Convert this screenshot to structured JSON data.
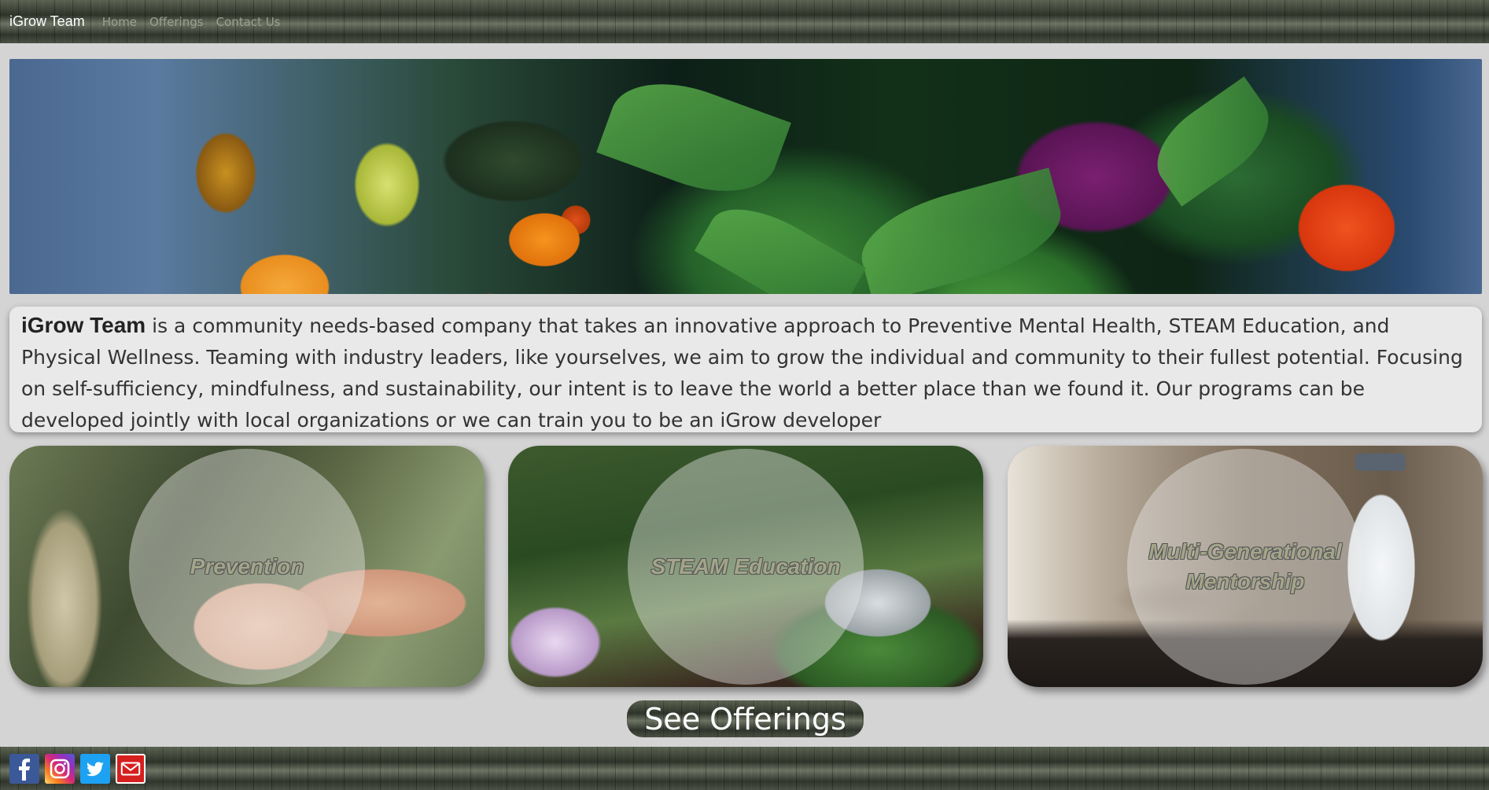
{
  "navbar": {
    "brand": "iGrow Team",
    "links": [
      "Home",
      "Offerings",
      "Contact Us"
    ]
  },
  "intro": {
    "brand": "iGrow Team",
    "text": " is a community needs-based company that takes an innovative approach to Preventive Mental Health, STEAM Education, and Physical Wellness. Teaming with industry leaders, like yourselves, we aim to grow the individual and community to their fullest potential. Focusing on self-sufficiency, mindfulness, and sustainability, our intent is to leave the world a better place than we found it. Our programs can be developed jointly with local organizations or we can train you to be an iGrow developer"
  },
  "cards": [
    {
      "title": "Prevention"
    },
    {
      "title": "STEAM Education"
    },
    {
      "title": "Multi-Generational Mentorship"
    }
  ],
  "cta": {
    "label": "See Offerings"
  },
  "footer": {
    "icons": [
      "facebook-icon",
      "instagram-icon",
      "twitter-icon",
      "email-icon"
    ]
  },
  "colors": {
    "background": "#d4d4d4",
    "card_title": "#a3a58a",
    "intro_bg": "#e9e9e9",
    "facebook": "#3b5998",
    "twitter": "#1da1f2",
    "email": "#d61f1f"
  }
}
